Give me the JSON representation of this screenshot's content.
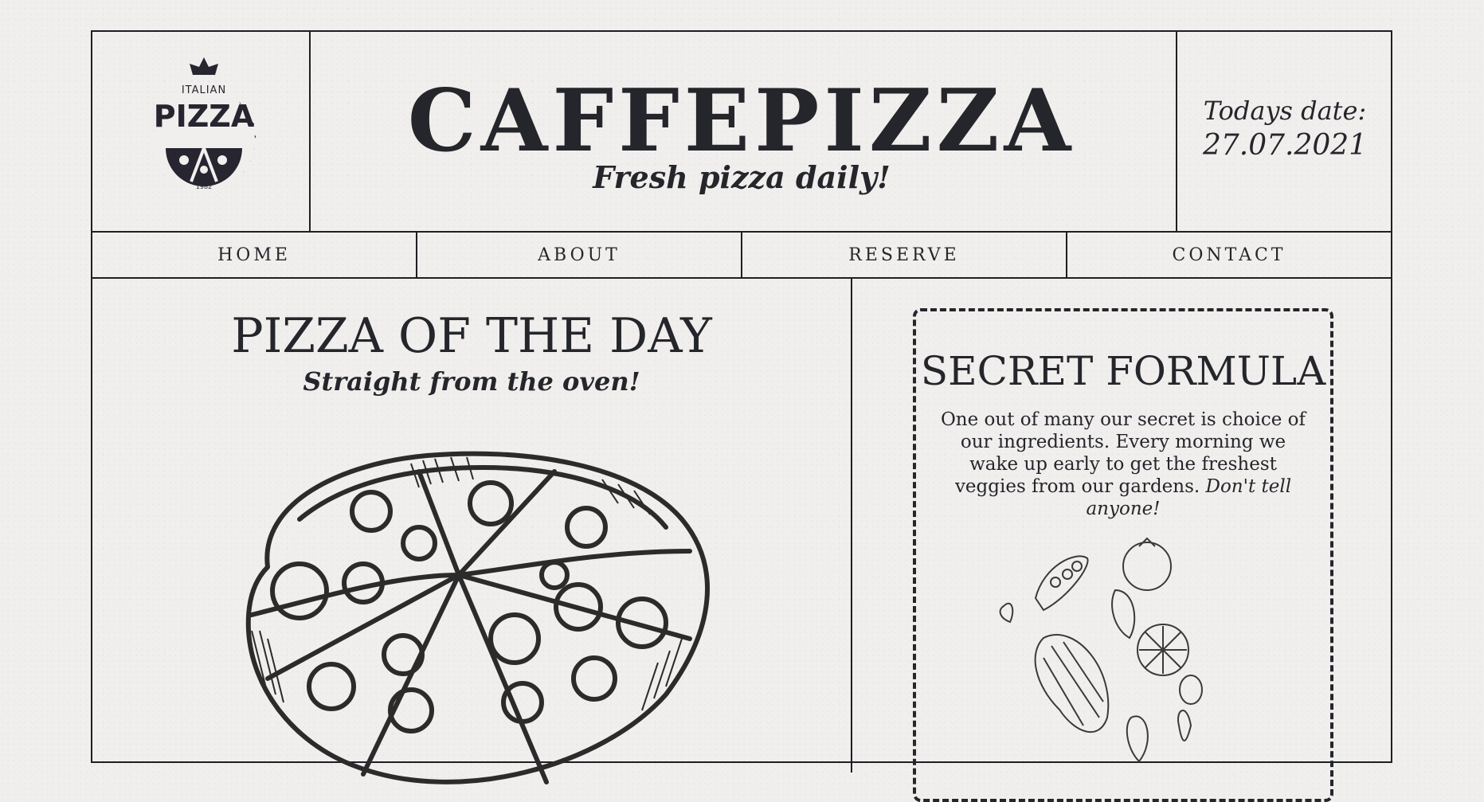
{
  "header": {
    "logo": {
      "top_text": "ITALIAN",
      "main_text": "PIZZA",
      "year": "1982"
    },
    "title": "CAFFEPIZZA",
    "tagline": "Fresh pizza daily!",
    "date_label": "Todays date:",
    "date_value": "27.07.2021"
  },
  "nav": {
    "items": [
      {
        "label": "HOME"
      },
      {
        "label": "ABOUT"
      },
      {
        "label": "RESERVE"
      },
      {
        "label": "CONTACT"
      }
    ]
  },
  "pizza_of_day": {
    "title": "PIZZA OF THE DAY",
    "subtitle": "Straight from the oven!"
  },
  "secret": {
    "title": "SECRET FORMULA",
    "text": "One out of many our secret is choice of our ingredients. Every morning we wake up early to get the freshest veggies from our gardens.",
    "emphasis": "Don't tell anyone!"
  },
  "colors": {
    "ink": "#24262b",
    "paper": "#f1efed"
  }
}
